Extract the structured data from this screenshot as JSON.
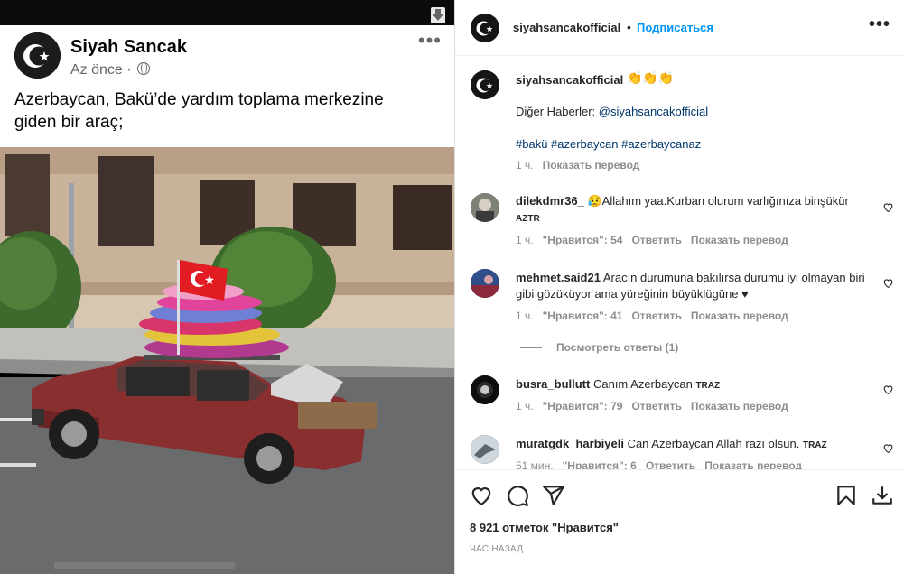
{
  "fb_post": {
    "author": "Siyah Sancak",
    "time": "Az önce · ",
    "text": "Azerbaycan, Bakü’de yardım toplama merkezine giden bir araç;",
    "more": "•••"
  },
  "ig": {
    "username": "siyahsancakofficial",
    "dot": "•",
    "follow": "Подписаться",
    "more": "•••",
    "caption": {
      "user": "siyahsancakofficial",
      "emoji": "👏👏👏",
      "line1_prefix": "Diğer Haberler: ",
      "line1_link": "@siyahsancakofficial",
      "hashtags": "#bakü #azerbaycan #azerbaycanaz",
      "time": "1 ч.",
      "translate": "Показать перевод"
    },
    "comments": [
      {
        "user": "dilekdmr36_",
        "text": "😥Allahım yaa.Kurban olurum varlığınıza binşükür",
        "tag": "AZTR",
        "time": "1 ч.",
        "likes": "\"Нравится\": 54",
        "reply": "Ответить",
        "translate": "Показать перевод"
      },
      {
        "user": "mehmet.said21",
        "text": "Aracın durumuna bakılırsa durumu iyi olmayan biri gibi gözüküyor ama yüreğinin büyüklügüne ♥",
        "time": "1 ч.",
        "likes": "\"Нравится\": 41",
        "reply": "Ответить",
        "translate": "Показать перевод"
      },
      {
        "user": "busra_bullutt",
        "text": "Canım Azerbaycan",
        "tag": "TRAZ",
        "time": "1 ч.",
        "likes": "\"Нравится\": 79",
        "reply": "Ответить",
        "translate": "Показать перевод"
      },
      {
        "user": "muratgdk_harbiyeli",
        "text": "Can Azerbaycan Allah razı olsun.",
        "tag": "TRAZ",
        "time": "51 мин.",
        "likes": "\"Нравится\": 6",
        "reply": "Ответить",
        "translate": "Показать перевод"
      }
    ],
    "view_replies": "Посмотреть ответы (1)",
    "likes_count": "8 921 отметок \"Нравится\"",
    "posted_ago": "ЧАС НАЗАД"
  }
}
